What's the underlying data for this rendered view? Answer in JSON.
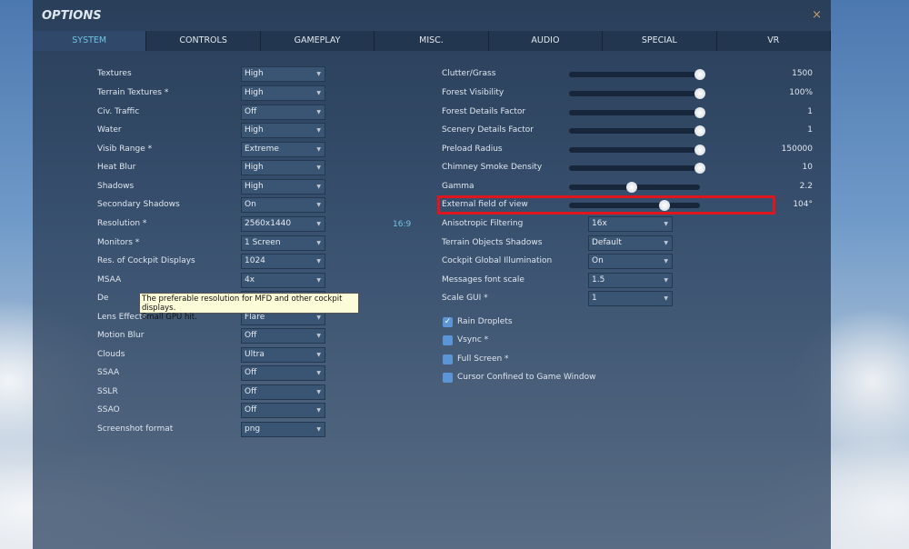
{
  "window": {
    "title": "OPTIONS",
    "close": "×"
  },
  "tabs": [
    "SYSTEM",
    "CONTROLS",
    "GAMEPLAY",
    "MISC.",
    "AUDIO",
    "SPECIAL",
    "VR"
  ],
  "left": [
    {
      "label": "Textures",
      "value": "High"
    },
    {
      "label": "Terrain Textures *",
      "value": "High"
    },
    {
      "label": "Civ. Traffic",
      "value": "Off"
    },
    {
      "label": "Water",
      "value": "High"
    },
    {
      "label": "Visib Range *",
      "value": "Extreme"
    },
    {
      "label": "Heat Blur",
      "value": "High"
    },
    {
      "label": "Shadows",
      "value": "High"
    },
    {
      "label": "Secondary Shadows",
      "value": "On"
    },
    {
      "label": "Resolution *",
      "value": "2560x1440"
    },
    {
      "label": "Monitors *",
      "value": "1 Screen"
    },
    {
      "label": "Res. of Cockpit Displays",
      "value": "1024"
    },
    {
      "label": "MSAA",
      "value": "4x"
    },
    {
      "label": "De",
      "value": ""
    },
    {
      "label": "Lens Effects",
      "value": "Flare"
    },
    {
      "label": "Motion Blur",
      "value": "Off"
    },
    {
      "label": "Clouds",
      "value": "Ultra"
    },
    {
      "label": "SSAA",
      "value": "Off"
    },
    {
      "label": "SSLR",
      "value": "Off"
    },
    {
      "label": "SSAO",
      "value": "Off"
    },
    {
      "label": "Screenshot format",
      "value": "png"
    }
  ],
  "aspect_ratio": "16:9",
  "sliders": [
    {
      "label": "Clutter/Grass",
      "value": "1500",
      "fraction": 1.0
    },
    {
      "label": "Forest Visibility",
      "value": "100%",
      "fraction": 1.0
    },
    {
      "label": "Forest Details Factor",
      "value": "1",
      "fraction": 1.0
    },
    {
      "label": "Scenery Details Factor",
      "value": "1",
      "fraction": 1.0
    },
    {
      "label": "Preload Radius",
      "value": "150000",
      "fraction": 1.0
    },
    {
      "label": "Chimney Smoke Density",
      "value": "10",
      "fraction": 1.0
    },
    {
      "label": "Gamma",
      "value": "2.2",
      "fraction": 0.48
    },
    {
      "label": "External field of view",
      "value": "104°",
      "fraction": 0.73
    }
  ],
  "right_dropdowns": [
    {
      "label": "Anisotropic Filtering",
      "value": "16x"
    },
    {
      "label": "Terrain Objects Shadows",
      "value": "Default"
    },
    {
      "label": "Cockpit Global Illumination",
      "value": "On"
    },
    {
      "label": "Messages font scale",
      "value": "1.5"
    },
    {
      "label": "Scale GUI *",
      "value": "1"
    }
  ],
  "checkboxes": [
    {
      "label": "Rain Droplets",
      "checked": true
    },
    {
      "label": "Vsync *",
      "checked": false
    },
    {
      "label": "Full Screen *",
      "checked": false
    },
    {
      "label": "Cursor Confined to Game Window",
      "checked": false
    }
  ],
  "tooltip": {
    "line1": "The preferable resolution for MFD and other cockpit displays.",
    "line2": "Small GPU hit."
  }
}
